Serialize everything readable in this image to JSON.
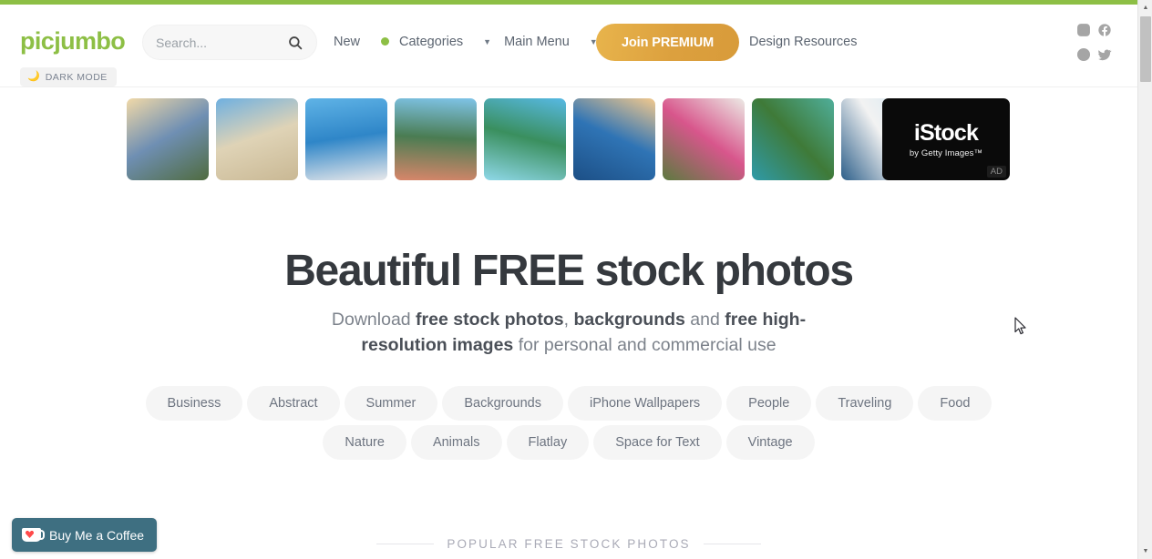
{
  "brand": {
    "logo_text": "picjumbo",
    "green": "#8dbf45"
  },
  "header": {
    "search": {
      "placeholder": "Search...",
      "value": ""
    },
    "nav": [
      {
        "label": "New",
        "has_dot": true,
        "has_caret": false
      },
      {
        "label": "Categories",
        "has_dot": false,
        "has_caret": true
      },
      {
        "label": "Main Menu",
        "has_dot": false,
        "has_caret": true
      }
    ],
    "premium_button": "Join PREMIUM",
    "design_resources": "Design Resources",
    "social": [
      "instagram-icon",
      "facebook-icon",
      "pinterest-icon",
      "twitter-icon"
    ],
    "dark_mode": {
      "label": "DARK MODE",
      "icon": "moon-icon"
    }
  },
  "strip": {
    "thumbnails": [
      {
        "alt": "Acropolis of Athens at sunset",
        "c1": "#f1d9a8",
        "c2": "#6f8fb3",
        "c3": "#4f6b3f"
      },
      {
        "alt": "Parthenon columns blue sky",
        "c1": "#6fb0e0",
        "c2": "#dfd3b6",
        "c3": "#c9b894"
      },
      {
        "alt": "Santorini blue domes over sea",
        "c1": "#5fb3e6",
        "c2": "#2f86c8",
        "c3": "#e8e8ea"
      },
      {
        "alt": "Assos colorful harbour Kefalonia",
        "c1": "#7fc4e8",
        "c2": "#4a7c52",
        "c3": "#d8866a"
      },
      {
        "alt": "Navagio beach white cliffs",
        "c1": "#57b9e4",
        "c2": "#3a8f5e",
        "c3": "#8fd8e8"
      },
      {
        "alt": "Oia Santorini dome at dusk",
        "c1": "#f3c98d",
        "c2": "#2f74b5",
        "c3": "#1c4f86"
      },
      {
        "alt": "Whitewashed alley with bougainvillea",
        "c1": "#eceae5",
        "c2": "#d8568c",
        "c3": "#5c7a3f"
      },
      {
        "alt": "Green bay turquoise water Corfu",
        "c1": "#4fae9a",
        "c2": "#3f7a38",
        "c3": "#2f9aa8"
      },
      {
        "alt": "White terrace with blue door",
        "c1": "#cfe6f2",
        "c2": "#f2f2f2",
        "c3": "#2d5f8a"
      }
    ],
    "ad": {
      "title": "iStock",
      "subtitle": "by Getty Images™",
      "badge": "AD"
    }
  },
  "hero": {
    "title": "Beautiful FREE stock photos",
    "subtitle_parts": [
      {
        "text": "Download ",
        "bold": false
      },
      {
        "text": "free stock photos",
        "bold": true
      },
      {
        "text": ", ",
        "bold": false
      },
      {
        "text": "backgrounds",
        "bold": true
      },
      {
        "text": " and ",
        "bold": false
      },
      {
        "text": "free high-resolution images",
        "bold": true
      },
      {
        "text": " for personal and commercial use",
        "bold": false
      }
    ]
  },
  "tags": [
    "Business",
    "Abstract",
    "Summer",
    "Backgrounds",
    "iPhone Wallpapers",
    "People",
    "Traveling",
    "Food",
    "Nature",
    "Animals",
    "Flatlay",
    "Space for Text",
    "Vintage"
  ],
  "section": {
    "title": "POPULAR FREE STOCK PHOTOS"
  },
  "buy_me_a_coffee": {
    "label": "Buy Me a Coffee",
    "icon": "coffee-cup-icon"
  },
  "scrollbar": {
    "up": "▲",
    "down": "▼"
  }
}
